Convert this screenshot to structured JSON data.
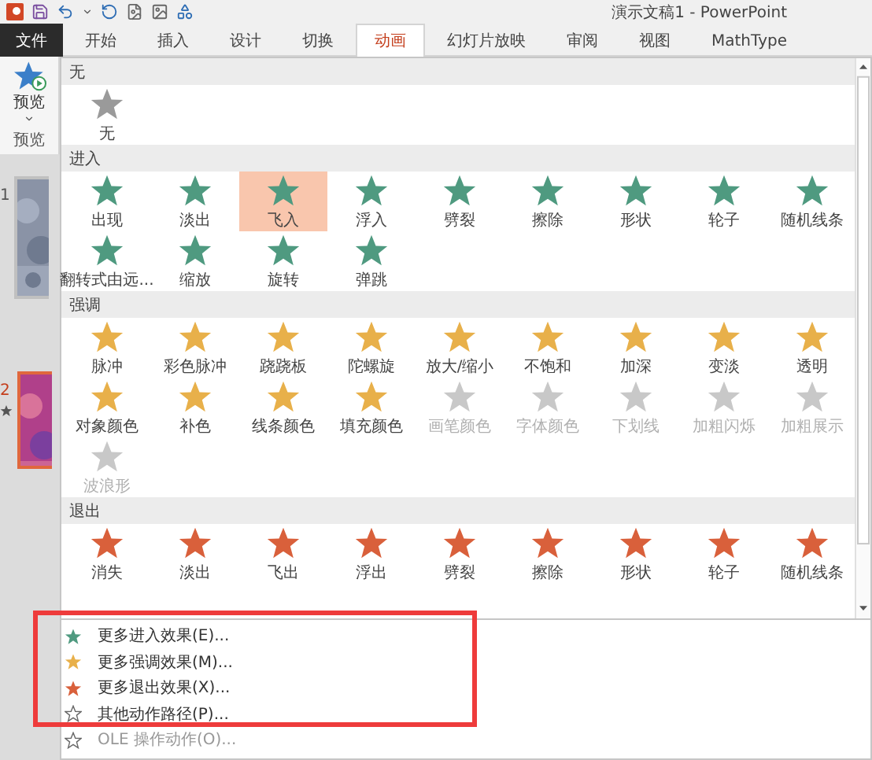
{
  "window": {
    "title": "演示文稿1 - PowerPoint"
  },
  "tabs": [
    {
      "label": "文件",
      "kind": "file",
      "selected": false
    },
    {
      "label": "开始",
      "kind": "tab",
      "selected": false
    },
    {
      "label": "插入",
      "kind": "tab",
      "selected": false
    },
    {
      "label": "设计",
      "kind": "tab",
      "selected": false
    },
    {
      "label": "切换",
      "kind": "tab",
      "selected": false
    },
    {
      "label": "动画",
      "kind": "tab",
      "selected": true
    },
    {
      "label": "幻灯片放映",
      "kind": "tab",
      "selected": false
    },
    {
      "label": "审阅",
      "kind": "tab",
      "selected": false
    },
    {
      "label": "视图",
      "kind": "tab",
      "selected": false
    },
    {
      "label": "MathType",
      "kind": "tab",
      "selected": false
    }
  ],
  "preview": {
    "button": "预览",
    "group": "预览"
  },
  "slides": [
    {
      "number": "1",
      "selected": false,
      "animated": false
    },
    {
      "number": "2",
      "selected": true,
      "animated": true
    }
  ],
  "gallery": {
    "sections": [
      {
        "title": "无",
        "kind": "none",
        "items": [
          {
            "label": "无",
            "selected": false,
            "disabled": false
          }
        ]
      },
      {
        "title": "进入",
        "kind": "entrance",
        "items": [
          {
            "label": "出现",
            "selected": false,
            "disabled": false
          },
          {
            "label": "淡出",
            "selected": false,
            "disabled": false
          },
          {
            "label": "飞入",
            "selected": true,
            "disabled": false
          },
          {
            "label": "浮入",
            "selected": false,
            "disabled": false
          },
          {
            "label": "劈裂",
            "selected": false,
            "disabled": false
          },
          {
            "label": "擦除",
            "selected": false,
            "disabled": false
          },
          {
            "label": "形状",
            "selected": false,
            "disabled": false
          },
          {
            "label": "轮子",
            "selected": false,
            "disabled": false
          },
          {
            "label": "随机线条",
            "selected": false,
            "disabled": false
          },
          {
            "label": "翻转式由远...",
            "selected": false,
            "disabled": false
          },
          {
            "label": "缩放",
            "selected": false,
            "disabled": false
          },
          {
            "label": "旋转",
            "selected": false,
            "disabled": false
          },
          {
            "label": "弹跳",
            "selected": false,
            "disabled": false
          }
        ]
      },
      {
        "title": "强调",
        "kind": "emphasis",
        "items": [
          {
            "label": "脉冲",
            "selected": false,
            "disabled": false
          },
          {
            "label": "彩色脉冲",
            "selected": false,
            "disabled": false
          },
          {
            "label": "跷跷板",
            "selected": false,
            "disabled": false
          },
          {
            "label": "陀螺旋",
            "selected": false,
            "disabled": false
          },
          {
            "label": "放大/缩小",
            "selected": false,
            "disabled": false
          },
          {
            "label": "不饱和",
            "selected": false,
            "disabled": false
          },
          {
            "label": "加深",
            "selected": false,
            "disabled": false
          },
          {
            "label": "变淡",
            "selected": false,
            "disabled": false
          },
          {
            "label": "透明",
            "selected": false,
            "disabled": false
          },
          {
            "label": "对象颜色",
            "selected": false,
            "disabled": false
          },
          {
            "label": "补色",
            "selected": false,
            "disabled": false
          },
          {
            "label": "线条颜色",
            "selected": false,
            "disabled": false
          },
          {
            "label": "填充颜色",
            "selected": false,
            "disabled": false
          },
          {
            "label": "画笔颜色",
            "selected": false,
            "disabled": true
          },
          {
            "label": "字体颜色",
            "selected": false,
            "disabled": true
          },
          {
            "label": "下划线",
            "selected": false,
            "disabled": true
          },
          {
            "label": "加粗闪烁",
            "selected": false,
            "disabled": true
          },
          {
            "label": "加粗展示",
            "selected": false,
            "disabled": true
          },
          {
            "label": "波浪形",
            "selected": false,
            "disabled": true
          }
        ]
      },
      {
        "title": "退出",
        "kind": "exit",
        "items": [
          {
            "label": "消失",
            "selected": false,
            "disabled": false
          },
          {
            "label": "淡出",
            "selected": false,
            "disabled": false
          },
          {
            "label": "飞出",
            "selected": false,
            "disabled": false
          },
          {
            "label": "浮出",
            "selected": false,
            "disabled": false
          },
          {
            "label": "劈裂",
            "selected": false,
            "disabled": false
          },
          {
            "label": "擦除",
            "selected": false,
            "disabled": false
          },
          {
            "label": "形状",
            "selected": false,
            "disabled": false
          },
          {
            "label": "轮子",
            "selected": false,
            "disabled": false
          },
          {
            "label": "随机线条",
            "selected": false,
            "disabled": false
          }
        ]
      }
    ]
  },
  "menu": [
    {
      "label": "更多进入效果(E)...",
      "kind": "entrance",
      "disabled": false
    },
    {
      "label": "更多强调效果(M)...",
      "kind": "emphasis",
      "disabled": false
    },
    {
      "label": "更多退出效果(X)...",
      "kind": "exit",
      "disabled": false
    },
    {
      "label": "其他动作路径(P)...",
      "kind": "path",
      "disabled": false
    },
    {
      "label": "OLE 操作动作(O)...",
      "kind": "ole",
      "disabled": true
    }
  ]
}
